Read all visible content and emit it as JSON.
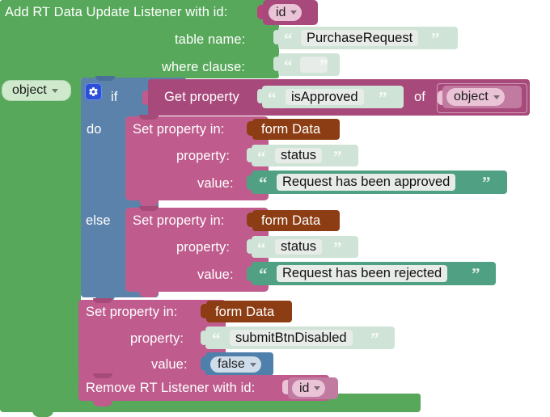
{
  "app": {
    "kind": "blockly-workspace",
    "background": "#ffffff"
  },
  "colors": {
    "event_green": "#57a85a",
    "statement_pink": "#bf5c8d",
    "control_blue": "#5b82ab",
    "variable_brown": "#8c3d13",
    "string_mint": "#cfe3d6",
    "string_teal": "#50a184",
    "variable_green": "#cfe9cc",
    "dropdown_pink": "#eac3d7",
    "dropdown_blue": "#cfdce9",
    "gear_blue": "#2b4fd6",
    "hat_magenta": "#b8447e"
  },
  "blocks": {
    "add_listener": {
      "title": "Add RT Data Update Listener with id:",
      "id_dropdown": "id",
      "rows": [
        {
          "label": "table name:",
          "value": "PurchaseRequest"
        },
        {
          "label": "where clause:",
          "value": ""
        }
      ]
    },
    "object_var": {
      "label": "object"
    },
    "if_block": {
      "gear_icon": "gear-icon",
      "if_label": "if",
      "do_label": "do",
      "else_label": "else",
      "condition": {
        "get_label": "Get property",
        "property": "isApproved",
        "of_label": "of",
        "object": "object"
      },
      "do_branch": {
        "set_label": "Set property in:",
        "target": "form Data",
        "property_label": "property:",
        "property": "status",
        "value_label": "value:",
        "value": "Request has been approved"
      },
      "else_branch": {
        "set_label": "Set property in:",
        "target": "form Data",
        "property_label": "property:",
        "property": "status",
        "value_label": "value:",
        "value": "Request has been rejected"
      }
    },
    "set_submit": {
      "set_label": "Set property in:",
      "target": "form Data",
      "property_label": "property:",
      "property": "submitBtnDisabled",
      "value_label": "value:",
      "value": "false"
    },
    "remove_listener": {
      "title": "Remove RT Listener with id:",
      "id_dropdown": "id"
    }
  }
}
